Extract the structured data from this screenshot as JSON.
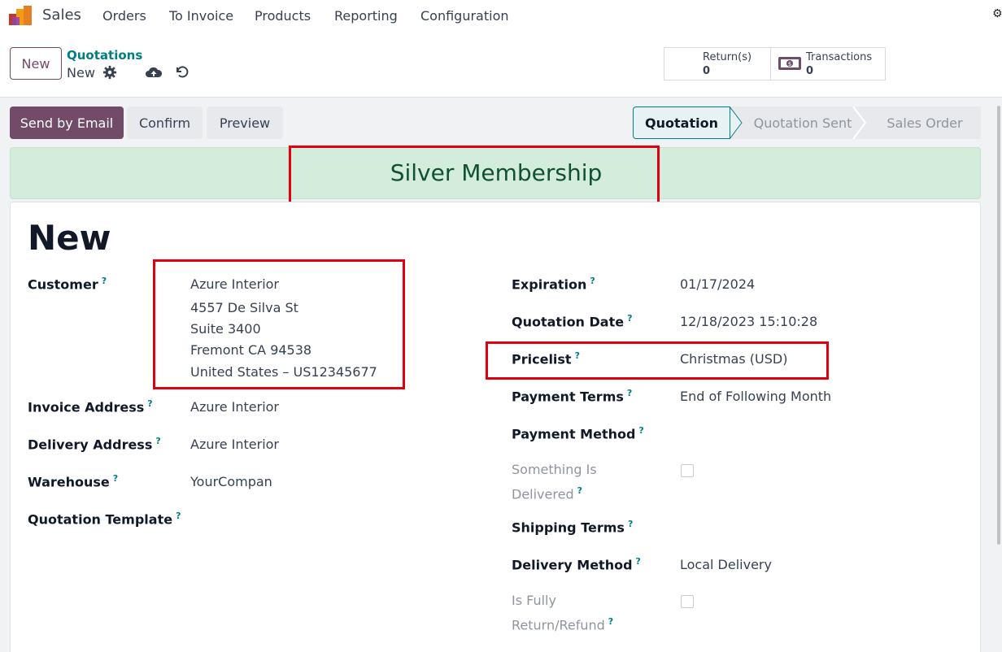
{
  "topnav": {
    "app_name": "Sales",
    "menu": [
      "Orders",
      "To Invoice",
      "Products",
      "Reporting",
      "Configuration"
    ]
  },
  "control": {
    "new_label": "New",
    "breadcrumb_parent": "Quotations",
    "breadcrumb_current": "New",
    "smart_buttons": [
      {
        "label": "Return(s)",
        "value": "0"
      },
      {
        "label": "Transactions",
        "value": "0",
        "icon": "money-icon"
      }
    ]
  },
  "actions": {
    "send_email": "Send by Email",
    "confirm": "Confirm",
    "preview": "Preview"
  },
  "statusbar": {
    "stages": [
      "Quotation",
      "Quotation Sent",
      "Sales Order"
    ],
    "active": "Quotation"
  },
  "banner": {
    "text": "Silver Membership"
  },
  "record": {
    "name": "New"
  },
  "form_left": {
    "customer_label": "Customer",
    "customer_lines": [
      "Azure Interior",
      "4557 De Silva St",
      "Suite 3400",
      "Fremont CA 94538",
      "United States – US12345677"
    ],
    "invoice_label": "Invoice Address",
    "invoice_value": "Azure Interior",
    "delivery_label": "Delivery Address",
    "delivery_value": "Azure Interior",
    "warehouse_label": "Warehouse",
    "warehouse_value": "YourCompan",
    "template_label": "Quotation Template"
  },
  "form_right": {
    "expiration_label": "Expiration",
    "expiration_value": "01/17/2024",
    "quotation_date_label": "Quotation Date",
    "quotation_date_value": "12/18/2023 15:10:28",
    "pricelist_label": "Pricelist",
    "pricelist_value": "Christmas (USD)",
    "payment_terms_label": "Payment Terms",
    "payment_terms_value": "End of Following Month",
    "payment_method_label": "Payment Method",
    "something_label_1": "Something Is",
    "something_label_2": "Delivered",
    "shipping_terms_label": "Shipping Terms",
    "delivery_method_label": "Delivery Method",
    "delivery_method_value": "Local Delivery",
    "fully_label_1": "Is Fully",
    "fully_label_2": "Return/Refund"
  },
  "help_mark": "?",
  "colors": {
    "brand": "#714b67",
    "link": "#017e84",
    "banner_bg": "#d4ecdb",
    "highlight": "#e1000f"
  }
}
